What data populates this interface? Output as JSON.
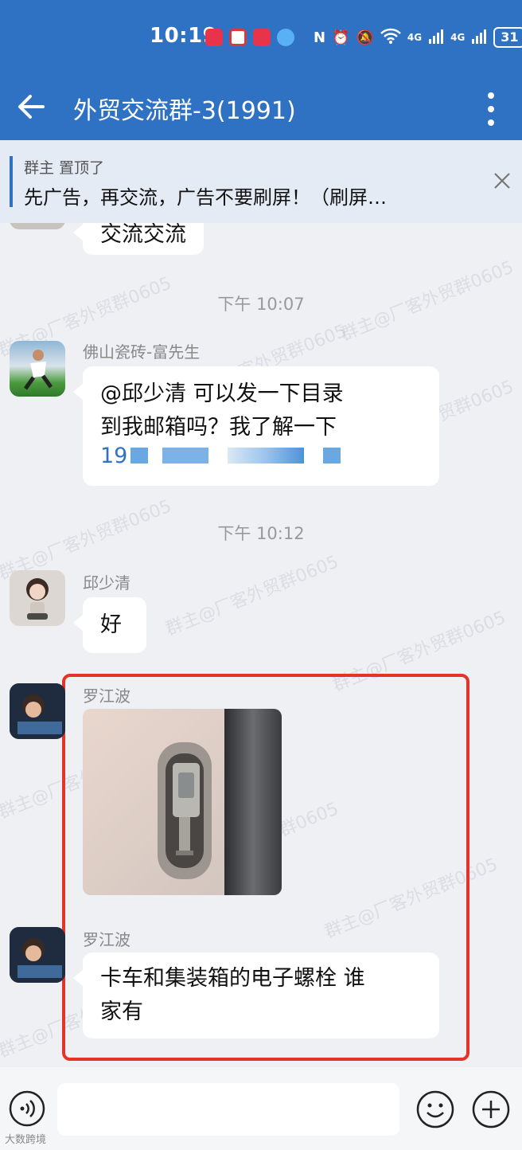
{
  "status_bar": {
    "time": "10:19",
    "network_1": "4G",
    "network_2": "4G",
    "battery": "31"
  },
  "header": {
    "title": "外贸交流群-3(1991)",
    "back_icon": "back-arrow-icon",
    "more_icon": "more-vertical-icon"
  },
  "pinned": {
    "who": "群主 置顶了",
    "text": "先广告，再交流，广告不要刷屏！（刷屏…"
  },
  "messages": {
    "partial_text": "交流交流",
    "ts1": "下午 10:07",
    "msg1_sender": "佛山瓷砖-富先生",
    "msg1_line1": "@邱少清  可以发一下目录",
    "msg1_line2": "到我邮箱吗？我了解一下",
    "msg1_line3": "19",
    "ts2": "下午 10:12",
    "msg2_sender": "邱少清",
    "msg2_text": "好",
    "msg3_sender": "罗江波",
    "msg4_sender": "罗江波",
    "msg4_line1": "卡车和集装箱的电子螺栓   谁",
    "msg4_line2": "家有"
  },
  "watermark_text": "群主@厂客外贸群0605",
  "input": {
    "placeholder": ""
  },
  "corner_mark": "大数跨境",
  "colors": {
    "header": "#2f72c4",
    "highlight": "#e5332a",
    "link": "#2f72c4"
  }
}
